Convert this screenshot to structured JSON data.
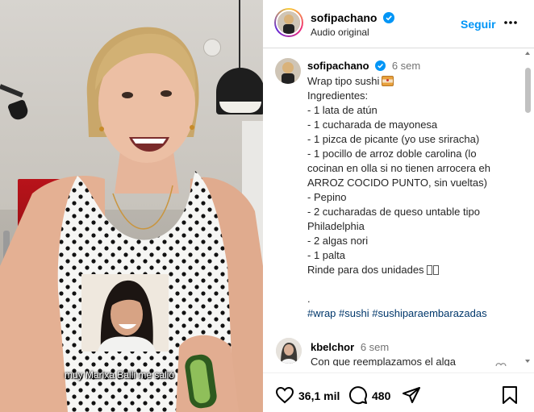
{
  "post": {
    "author": "sofipachano",
    "audio": "Audio original",
    "follow_label": "Seguir",
    "subtitle": "muy Marixa Balli me salió"
  },
  "caption": {
    "author": "sofipachano",
    "time": "6 sem",
    "title": "Wrap tipo sushi",
    "lines": [
      "Ingredientes:",
      "- 1 lata de atún",
      "- 1 cucharada de mayonesa",
      "- 1 pizca de picante (yo use sriracha)",
      "- 1 pocillo de arroz doble carolina (lo",
      "cocinan en olla si no tienen arrocera eh",
      "ARROZ COCIDO PUNTO, sin vueltas)",
      "- Pepino",
      "- 2 cucharadas de queso untable tipo",
      "Philadelphia",
      "- 2 algas nori",
      "- 1 palta"
    ],
    "yield": "Rinde para dos unidades",
    "dot": ".",
    "hashtags": [
      "#wrap",
      "#sushi",
      "#sushiparaembarazadas"
    ]
  },
  "comment": {
    "author": "kbelchor",
    "time": "6 sem",
    "text": "Con que reemplazamos el alga"
  },
  "actions": {
    "likes": "36,1 mil",
    "comments": "480"
  },
  "icons": {
    "verified": "verified-badge-icon",
    "more": "more-options-icon",
    "like": "heart-icon",
    "comment": "comment-icon",
    "share": "share-icon",
    "save": "bookmark-icon"
  },
  "colors": {
    "accent": "#0095f6",
    "hashtag": "#00376b",
    "muted": "#737373"
  }
}
